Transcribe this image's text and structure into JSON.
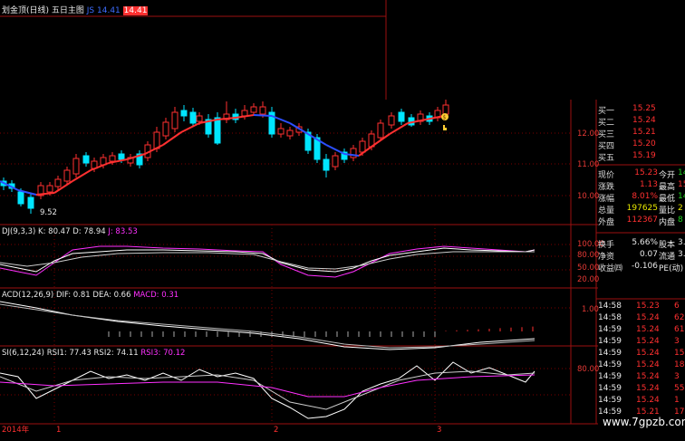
{
  "header": {
    "title_prefix": "划金顶(日线) 五日主图",
    "ma_name": "JS",
    "ma_value": "14.41",
    "price_box": "14.41"
  },
  "main_axis": {
    "ticks": [
      "12.00",
      "11.00",
      "10.00"
    ],
    "low_marker": "9.52"
  },
  "kdj": {
    "header_name": "DJ(9,3,3)",
    "k_text": "K: 80.47",
    "d_text": "D: 78.94",
    "j_text": "J: 83.53",
    "ticks": [
      "100.00",
      "80.00",
      "50.00",
      "20.00"
    ]
  },
  "macd": {
    "header_name": "ACD(12,26,9)",
    "dif_text": "DIF: 0.81",
    "dea_text": "DEA: 0.66",
    "macd_text": "MACD: 0.31",
    "ticks": [
      "1.00"
    ]
  },
  "rsi": {
    "header_name": "SI(6,12,24)",
    "rsi1_text": "RSI1: 77.43",
    "rsi2_text": "RSI2: 74.11",
    "rsi3_text": "RSI3: 70.12",
    "ticks": [
      "80.00"
    ]
  },
  "time_axis": {
    "year": "2014年",
    "marks": [
      "1",
      "2",
      "3"
    ]
  },
  "orderbook": [
    {
      "label": "买一",
      "price": "15.25"
    },
    {
      "label": "买二",
      "price": "15.24"
    },
    {
      "label": "买三",
      "price": "15.21"
    },
    {
      "label": "买四",
      "price": "15.20"
    },
    {
      "label": "买五",
      "price": "15.19"
    }
  ],
  "quote": [
    {
      "label": "现价",
      "value": "15.23",
      "label2": "今开",
      "value2": "14"
    },
    {
      "label": "涨跌",
      "value": "1.13",
      "label2": "最高",
      "value2": "15"
    },
    {
      "label": "涨幅",
      "value": "8.01%",
      "label2": "最低",
      "value2": "14"
    },
    {
      "label": "总量",
      "value": "197625",
      "label2": "量比",
      "value2": "2"
    },
    {
      "label": "外盘",
      "value": "112367",
      "label2": "内盘",
      "value2": "8"
    },
    {
      "label": "换手",
      "value": "5.66%",
      "label2": "股本",
      "value2": "3.4"
    },
    {
      "label": "净资",
      "value": "0.07",
      "label2": "流通",
      "value2": "3.4"
    },
    {
      "label": "收益㈣",
      "value": "-0.106",
      "label2": "PE(动)",
      "value2": ""
    }
  ],
  "ticks": [
    {
      "time": "14:58",
      "price": "15.23",
      "vol": "6"
    },
    {
      "time": "14:58",
      "price": "15.24",
      "vol": "62"
    },
    {
      "time": "14:59",
      "price": "15.24",
      "vol": "61"
    },
    {
      "time": "14:59",
      "price": "15.24",
      "vol": "3"
    },
    {
      "time": "14:59",
      "price": "15.24",
      "vol": "15"
    },
    {
      "time": "14:59",
      "price": "15.24",
      "vol": "18"
    },
    {
      "time": "14:59",
      "price": "15.24",
      "vol": "3"
    },
    {
      "time": "14:59",
      "price": "15.24",
      "vol": "55"
    },
    {
      "time": "14:59",
      "price": "15.24",
      "vol": "1"
    },
    {
      "time": "14:59",
      "price": "15.21",
      "vol": "179"
    }
  ],
  "watermark": "www.7gpzb.com",
  "colors": {
    "up": "#ff3030",
    "down": "#00e5ff",
    "ma_down": "#2c4fff",
    "grid": "#8b0000"
  }
}
